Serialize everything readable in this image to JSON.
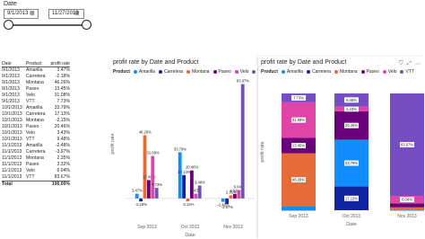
{
  "slicer": {
    "title": "Date",
    "start_date": "9/1/2013",
    "end_date": "11/27/2013",
    "range_fraction": [
      0,
      1
    ]
  },
  "table": {
    "headers": [
      "Date",
      "Product",
      "profit rate"
    ],
    "rows": [
      [
        "9/1/2013",
        "Amarilla",
        "3.47%"
      ],
      [
        "9/1/2013",
        "Carretera",
        "-2.18%"
      ],
      [
        "9/1/2013",
        "Montana",
        "46.26%"
      ],
      [
        "9/1/2013",
        "Paseo",
        "13.45%"
      ],
      [
        "9/1/2013",
        "Velo",
        "31.08%"
      ],
      [
        "9/1/2013",
        "VTT",
        "7.73%"
      ],
      [
        "10/1/2013",
        "Amarilla",
        "33.79%"
      ],
      [
        "10/1/2013",
        "Carretera",
        "17.13%"
      ],
      [
        "10/1/2013",
        "Montana",
        "-2.15%"
      ],
      [
        "10/1/2013",
        "Paseo",
        "20.46%"
      ],
      [
        "10/1/2013",
        "Velo",
        "3.43%"
      ],
      [
        "10/1/2013",
        "VTT",
        "9.48%"
      ],
      [
        "11/1/2013",
        "Amarilla",
        "-2.48%"
      ],
      [
        "11/1/2013",
        "Carretera",
        "-3.97%"
      ],
      [
        "11/1/2013",
        "Montana",
        "2.35%"
      ],
      [
        "11/1/2013",
        "Paseo",
        "3.32%"
      ],
      [
        "11/1/2013",
        "Velo",
        "6.04%"
      ],
      [
        "11/1/2013",
        "VTT",
        "83.67%"
      ]
    ],
    "total_label": "Total",
    "total_value": "100.00%"
  },
  "legend": {
    "label": "Product",
    "items": [
      {
        "name": "Amarilla",
        "color": "#118DFF"
      },
      {
        "name": "Carretera",
        "color": "#12239E"
      },
      {
        "name": "Montana",
        "color": "#E66C37"
      },
      {
        "name": "Paseo",
        "color": "#6B007B"
      },
      {
        "name": "Velo",
        "color": "#E044A7"
      },
      {
        "name": "VTT",
        "color": "#744EC2"
      }
    ]
  },
  "chart_data": [
    {
      "type": "bar",
      "title": "profit rate by Date and Product",
      "xlabel": "Date",
      "ylabel": "profit rate",
      "categories": [
        "Sep 2013",
        "Oct 2013",
        "Nov 2013"
      ],
      "series": [
        {
          "name": "Amarilla",
          "values": [
            3.47,
            33.79,
            -2.48
          ],
          "labels": [
            "3.47%",
            "33.79%",
            "-2.48%"
          ]
        },
        {
          "name": "Carretera",
          "values": [
            -2.18,
            17.13,
            -3.97
          ],
          "labels": [
            "-2.18%",
            "17.13%",
            "-3.97%"
          ]
        },
        {
          "name": "Montana",
          "values": [
            46.26,
            -2.15,
            2.35
          ],
          "labels": [
            "46.26%",
            "-2.15%",
            "2.35%"
          ]
        },
        {
          "name": "Paseo",
          "values": [
            13.45,
            20.46,
            3.32
          ],
          "labels": [
            "13.45%",
            "20.46%",
            "3.32%"
          ]
        },
        {
          "name": "Velo",
          "values": [
            31.08,
            3.43,
            6.04
          ],
          "labels": [
            "31.08%",
            "3.43%",
            "6.04%"
          ]
        },
        {
          "name": "VTT",
          "values": [
            7.73,
            9.48,
            83.67
          ],
          "labels": [
            "7.73%",
            "9.48%",
            "83.67%"
          ]
        }
      ],
      "ylim": [
        -6,
        86
      ],
      "grid": false,
      "legend": "top-left"
    },
    {
      "type": "bar",
      "stacked": "100%",
      "title": "profit rate by Date and Product",
      "xlabel": "Date",
      "ylabel": "profit rate",
      "categories": [
        "Sep 2013",
        "Oct 2013",
        "Nov 2013"
      ],
      "series": [
        {
          "name": "Amarilla",
          "values": [
            3.47,
            33.79,
            -2.48
          ]
        },
        {
          "name": "Carretera",
          "values": [
            -2.18,
            17.13,
            -3.97
          ]
        },
        {
          "name": "Montana",
          "values": [
            46.26,
            -2.15,
            2.35
          ]
        },
        {
          "name": "Paseo",
          "values": [
            13.45,
            20.46,
            3.32
          ]
        },
        {
          "name": "Velo",
          "values": [
            31.08,
            3.43,
            6.04
          ]
        },
        {
          "name": "VTT",
          "values": [
            7.73,
            9.48,
            83.67
          ]
        }
      ],
      "visible_labels": [
        {
          "category": "Sep 2013",
          "series": "VTT",
          "text": "7.73%"
        },
        {
          "category": "Sep 2013",
          "series": "Velo",
          "text": "31.08%"
        },
        {
          "category": "Sep 2013",
          "series": "Paseo",
          "text": "13.45%"
        },
        {
          "category": "Sep 2013",
          "series": "Montana",
          "text": "46.26%"
        },
        {
          "category": "Oct 2013",
          "series": "VTT",
          "text": "9.48%"
        },
        {
          "category": "Oct 2013",
          "series": "Velo",
          "text": "3.43%"
        },
        {
          "category": "Oct 2013",
          "series": "Paseo",
          "text": "20.46%"
        },
        {
          "category": "Oct 2013",
          "series": "Carretera",
          "text": "17.13%"
        },
        {
          "category": "Oct 2013",
          "series": "Amarilla",
          "text": "33.79%"
        },
        {
          "category": "Nov 2013",
          "series": "VTT",
          "text": "83.67%"
        },
        {
          "category": "Nov 2013",
          "series": "Velo",
          "text": "6.04%"
        }
      ],
      "grid": false,
      "legend": "top-left"
    }
  ],
  "toolbar_icons": [
    "filter-icon",
    "focus-mode-icon",
    "more-options-icon"
  ]
}
